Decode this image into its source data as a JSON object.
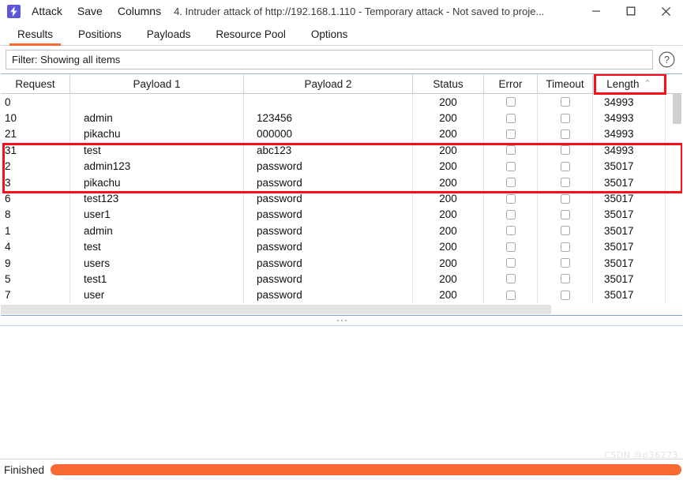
{
  "window": {
    "app_icon": "burp-lightning-icon",
    "menu": [
      "Attack",
      "Save",
      "Columns"
    ],
    "title": "4. Intruder attack of http://192.168.1.110 - Temporary attack - Not saved to proje...",
    "controls": {
      "minimize": "minimize-icon",
      "maximize": "maximize-icon",
      "close": "close-icon"
    }
  },
  "tabs": [
    {
      "label": "Results",
      "active": true
    },
    {
      "label": "Positions",
      "active": false
    },
    {
      "label": "Payloads",
      "active": false
    },
    {
      "label": "Resource Pool",
      "active": false
    },
    {
      "label": "Options",
      "active": false
    }
  ],
  "filter": {
    "text": "Filter: Showing all items",
    "help_icon": "question-mark-icon"
  },
  "table": {
    "columns": [
      "Request",
      "Payload 1",
      "Payload 2",
      "Status",
      "Error",
      "Timeout",
      "Length"
    ],
    "sorted_column": "Length",
    "sort_caret": "⌃",
    "rows": [
      {
        "request": "0",
        "payload1": "",
        "payload2": "",
        "status": "200",
        "error": false,
        "timeout": false,
        "length": "34993"
      },
      {
        "request": "10",
        "payload1": "admin",
        "payload2": "123456",
        "status": "200",
        "error": false,
        "timeout": false,
        "length": "34993"
      },
      {
        "request": "21",
        "payload1": "pikachu",
        "payload2": "000000",
        "status": "200",
        "error": false,
        "timeout": false,
        "length": "34993"
      },
      {
        "request": "31",
        "payload1": "test",
        "payload2": "abc123",
        "status": "200",
        "error": false,
        "timeout": false,
        "length": "34993"
      },
      {
        "request": "2",
        "payload1": "admin123",
        "payload2": "password",
        "status": "200",
        "error": false,
        "timeout": false,
        "length": "35017"
      },
      {
        "request": "3",
        "payload1": "pikachu",
        "payload2": "password",
        "status": "200",
        "error": false,
        "timeout": false,
        "length": "35017"
      },
      {
        "request": "6",
        "payload1": "test123",
        "payload2": "password",
        "status": "200",
        "error": false,
        "timeout": false,
        "length": "35017"
      },
      {
        "request": "8",
        "payload1": "user1",
        "payload2": "password",
        "status": "200",
        "error": false,
        "timeout": false,
        "length": "35017"
      },
      {
        "request": "1",
        "payload1": "admin",
        "payload2": "password",
        "status": "200",
        "error": false,
        "timeout": false,
        "length": "35017"
      },
      {
        "request": "4",
        "payload1": "test",
        "payload2": "password",
        "status": "200",
        "error": false,
        "timeout": false,
        "length": "35017"
      },
      {
        "request": "9",
        "payload1": "users",
        "payload2": "password",
        "status": "200",
        "error": false,
        "timeout": false,
        "length": "35017"
      },
      {
        "request": "5",
        "payload1": "test1",
        "payload2": "password",
        "status": "200",
        "error": false,
        "timeout": false,
        "length": "35017"
      },
      {
        "request": "7",
        "payload1": "user",
        "payload2": "password",
        "status": "200",
        "error": false,
        "timeout": false,
        "length": "35017"
      }
    ]
  },
  "statusbar": {
    "status": "Finished",
    "progress_percent": 100
  },
  "watermark": "CSDN @p36273",
  "colors": {
    "accent_orange": "#f96932",
    "annotation_red": "#fc0d1b",
    "app_icon_purple": "#5b57d8"
  }
}
